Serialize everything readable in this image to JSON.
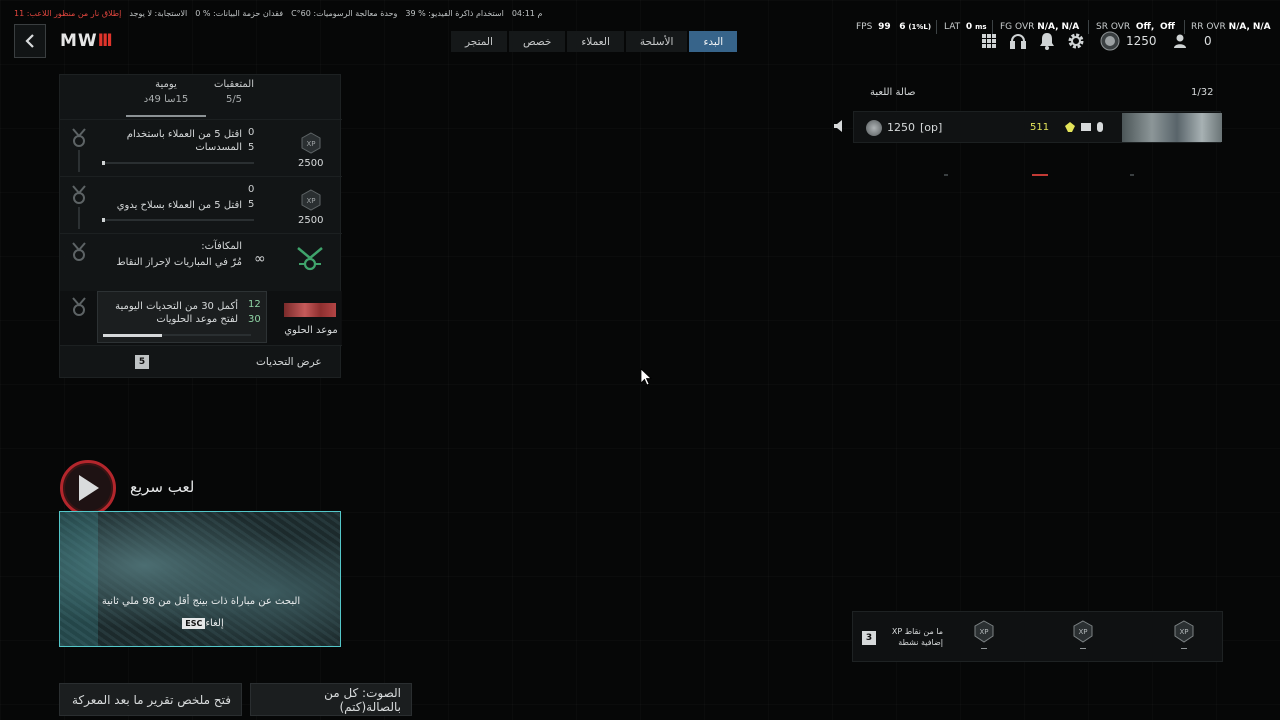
{
  "telemetry": {
    "time": "م 04:11",
    "vram": "استخدام ذاكرة الفيديو: % 39",
    "gpu_temp": "وحدة معالجة الرسوميات: 60°C",
    "packet_loss": "فقدان حزمة البيانات: % 0",
    "response": "الاستجابة: لا يوجد",
    "shots_from_player_view": "إطلاق نار من منظور اللاعب: 11"
  },
  "header": {
    "logo_text": "MW",
    "logo_roman": "III"
  },
  "tabs": [
    {
      "label": "البدء",
      "active": true
    },
    {
      "label": "الأسلحة",
      "active": false
    },
    {
      "label": "العملاء",
      "active": false
    },
    {
      "label": "خصص",
      "active": false
    },
    {
      "label": "المتجر",
      "active": false
    }
  ],
  "stats": {
    "fps_label": "FPS",
    "fps_value": "99",
    "fps_low": "6",
    "fps_low_pct": "(1%L)",
    "lat_label": "LAT",
    "lat_value": "0",
    "lat_unit": "ms",
    "fg_label": "FG OVR",
    "fg_value1": "N/A,",
    "fg_value2": "N/A",
    "sr_label": "SR OVR",
    "sr_value1": "Off,",
    "sr_value2": "Off",
    "rr_label": "RR OVR",
    "rr_value1": "N/A,",
    "rr_value2": "N/A"
  },
  "currency": {
    "value": "1250"
  },
  "friends": {
    "count": "0"
  },
  "challenges": {
    "tab_tracked": {
      "label": "المتعقبات",
      "sub": "5/5"
    },
    "tab_daily": {
      "label": "يومية",
      "sub": "15سا 49د"
    },
    "items": [
      {
        "text": "اقتل 5 من العملاء باستخدام المسدسات",
        "current": "0",
        "target": "5",
        "xp": "2500"
      },
      {
        "text": "اقتل 5 من العملاء بسلاح يدوي",
        "current": "0",
        "target": "5",
        "xp": "2500"
      }
    ],
    "reward_title": "المكافآت:",
    "reward_text": "مُرّ في المباريات لإحراز النقاط",
    "reward_symbol": "∞",
    "event": {
      "text": "أكمل 30 من التحديات اليومية لفتح موعد الحلويات",
      "current": "12",
      "target": "30",
      "label": "موعد الحلوي",
      "progress": 0.4
    },
    "show_label": "عرض التحديات",
    "show_count": "5"
  },
  "quick_play": {
    "title": "لعب سريع",
    "searching": "البحث عن مباراة ذات بينج أقل من 98 ملي ثانية",
    "cancel_label": "إلغاء",
    "cancel_key": "ESC"
  },
  "bottom_buttons": {
    "report": "فتح ملخص تقرير ما بعد المعركة",
    "voice": "الصوت: كل من بالصالة(كتم)"
  },
  "lobby": {
    "title": "صالة اللعبة",
    "count": "1/32",
    "player": {
      "skill": "1250",
      "name": "[op]",
      "level": "511"
    }
  },
  "xp_tokens": {
    "count": "3",
    "label": "ما من نقاط XP إضافية نشطة"
  },
  "colors": {
    "accent_tab": "#37648a",
    "quick_play_ring": "#b3262c",
    "quick_play_border": "#54c7c9",
    "level_yellow": "#e3e45a",
    "warning_red": "#e0463e"
  }
}
